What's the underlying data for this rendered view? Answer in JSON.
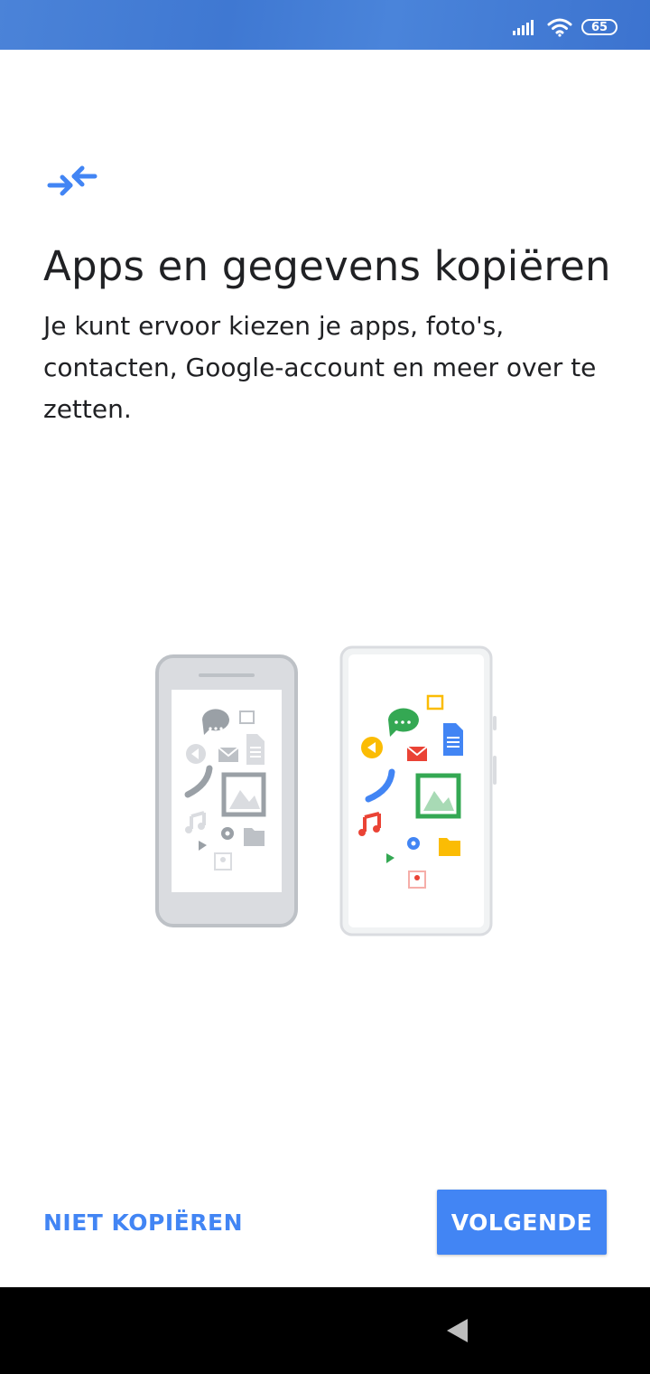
{
  "status_bar": {
    "battery_level": "65",
    "icons": [
      "signal-icon",
      "wifi-icon",
      "battery-icon"
    ]
  },
  "main": {
    "icon": "transfer-arrows-icon",
    "title": "Apps en gegevens kopiëren",
    "description": "Je kunt ervoor kiezen je apps, foto's, contacten, Google-account en meer over te zetten."
  },
  "actions": {
    "skip_label": "NIET KOPIËREN",
    "next_label": "VOLGENDE"
  },
  "colors": {
    "accent": "#4285f4",
    "status_bar": "#3f78d2",
    "green": "#34a853",
    "red": "#ea4335",
    "yellow": "#fbbc04",
    "grey_phone": "#bdc1c6"
  },
  "nav_bar": {
    "icons": [
      "back-icon"
    ]
  }
}
